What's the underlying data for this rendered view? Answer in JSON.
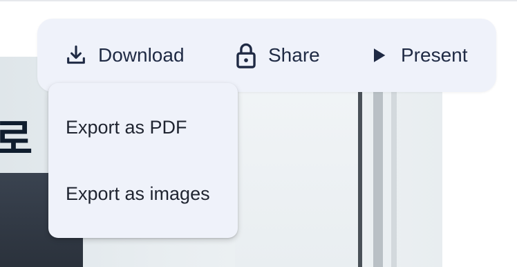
{
  "toolbar": {
    "download_label": "Download",
    "share_label": "Share",
    "present_label": "Present",
    "icons": {
      "download": "download-icon",
      "share": "lock-icon",
      "present": "play-icon"
    }
  },
  "download_menu": {
    "items": [
      {
        "label": "Export as PDF"
      },
      {
        "label": "Export as images"
      }
    ]
  },
  "background_slide": {
    "glyph": "로"
  },
  "colors": {
    "toolbar_bg": "#eff2fa",
    "text": "#1f2a44"
  }
}
